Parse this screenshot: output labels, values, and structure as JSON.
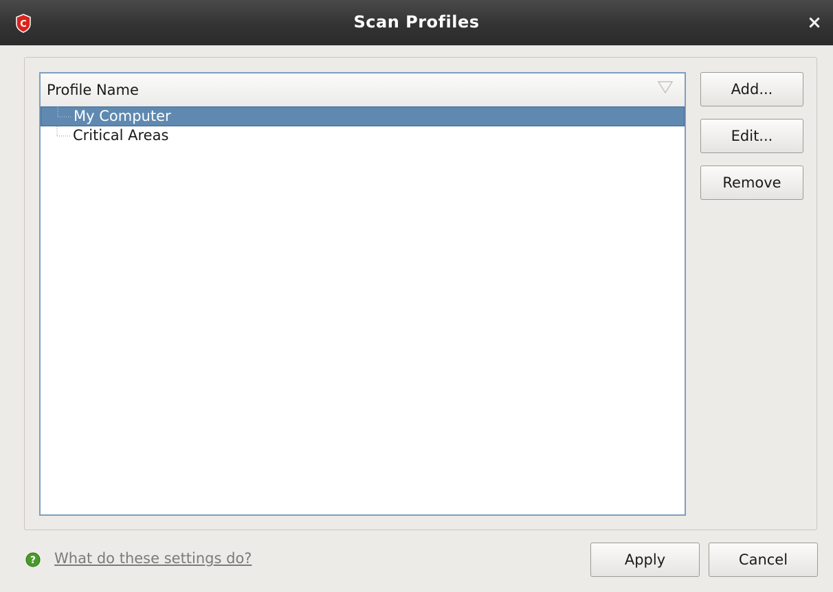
{
  "window": {
    "title": "Scan Profiles",
    "close_symbol": "×",
    "logo_letter": "C"
  },
  "profiles": {
    "column_header": "Profile Name",
    "items": [
      {
        "label": "My Computer",
        "selected": true
      },
      {
        "label": "Critical Areas",
        "selected": false
      }
    ]
  },
  "side_buttons": {
    "add": "Add...",
    "edit": "Edit...",
    "remove": "Remove"
  },
  "footer": {
    "help_link": "What do these settings do?",
    "apply": "Apply",
    "cancel": "Cancel"
  },
  "colors": {
    "selection": "#5f89b0",
    "title_bar": "#333333",
    "logo": "#d9241c",
    "help_icon": "#4a9a2a"
  }
}
